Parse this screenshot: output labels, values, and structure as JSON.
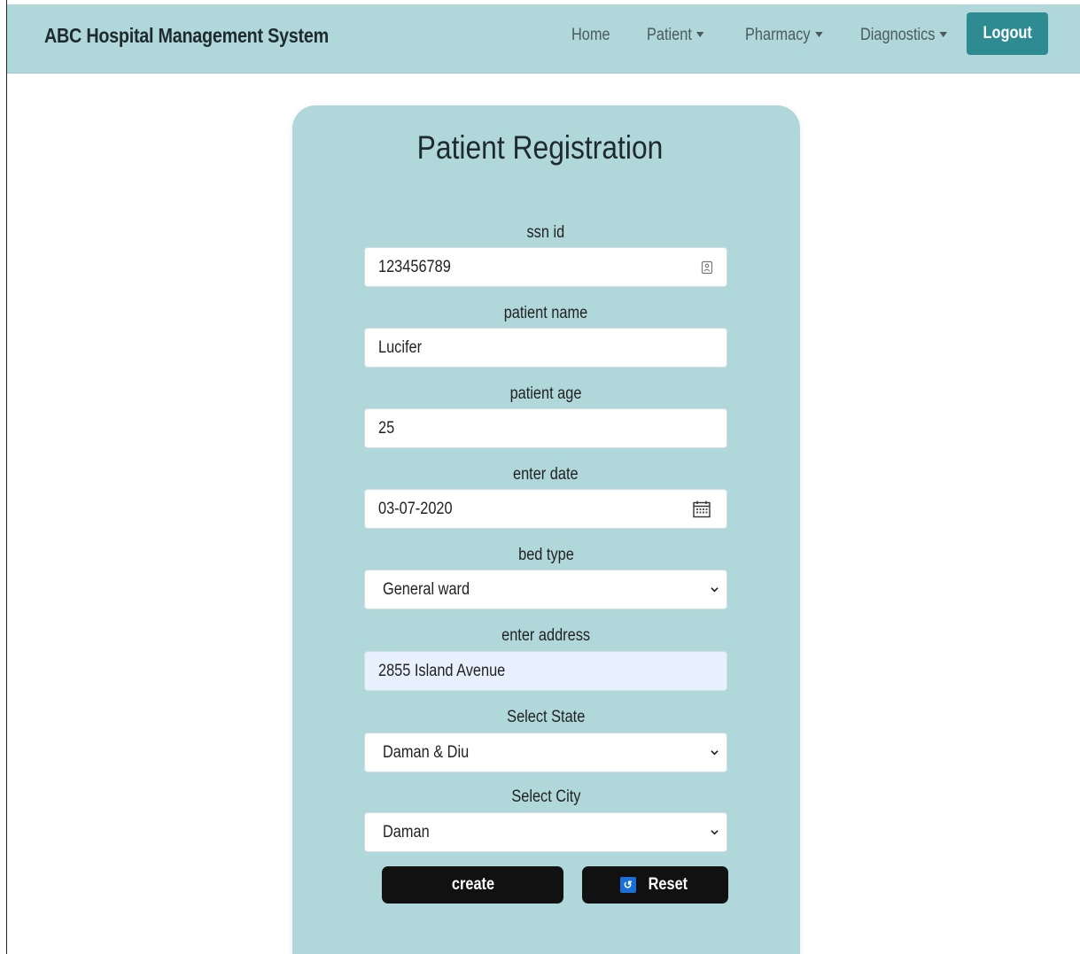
{
  "navbar": {
    "brand": "ABC Hospital Management System",
    "links": {
      "home": "Home",
      "patient": "Patient",
      "pharmacy": "Pharmacy",
      "diagnostics": "Diagnostics"
    },
    "logout_label": "Logout"
  },
  "form": {
    "title": "Patient Registration",
    "ssn": {
      "label": "ssn id",
      "value": "123456789"
    },
    "name": {
      "label": "patient name",
      "value": "Lucifer"
    },
    "age": {
      "label": "patient age",
      "value": "25"
    },
    "date": {
      "label": "enter date",
      "value": "03-07-2020"
    },
    "bed_type": {
      "label": "bed type",
      "selected": "General ward"
    },
    "address": {
      "label": "enter address",
      "value": "2855 Island Avenue"
    },
    "state": {
      "label": "Select State",
      "selected": "Daman & Diu"
    },
    "city": {
      "label": "Select City",
      "selected": "Daman"
    },
    "create_label": "create",
    "reset_label": "Reset"
  },
  "colors": {
    "navbar_bg": "#b0d8db",
    "card_bg": "#b0d8db",
    "logout_bg": "#2f8b92",
    "button_bg": "#111111",
    "autofill_bg": "#e8f0fe"
  },
  "icons": {
    "ssn_field": "contact-card-icon",
    "date_field": "calendar-icon",
    "select": "chevron-down-icon",
    "reset": "reset-icon"
  }
}
